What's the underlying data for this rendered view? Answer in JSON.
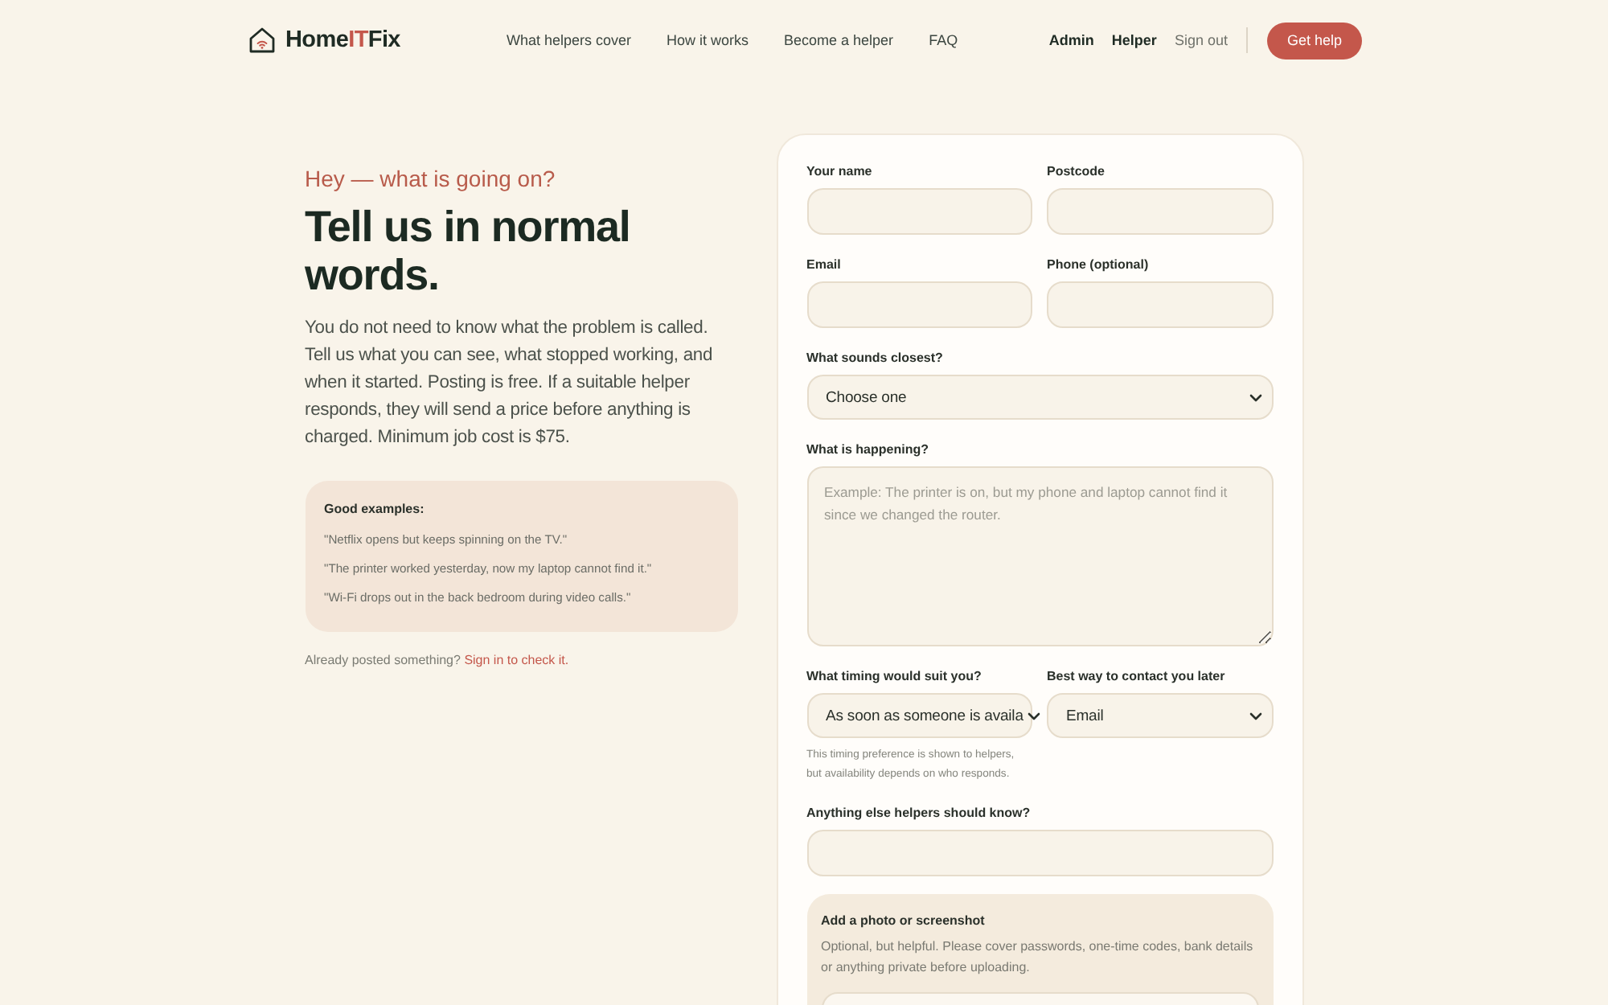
{
  "header": {
    "brand": {
      "prefix": "Home",
      "accent": "IT",
      "suffix": "Fix"
    },
    "nav": [
      {
        "label": "What helpers cover"
      },
      {
        "label": "How it works"
      },
      {
        "label": "Become a helper"
      },
      {
        "label": "FAQ"
      }
    ],
    "account_links": [
      {
        "label": "Admin",
        "kind": "strong"
      },
      {
        "label": "Helper",
        "kind": "strong"
      },
      {
        "label": "Sign out",
        "kind": "muted"
      }
    ],
    "cta": "Get help"
  },
  "intro": {
    "eyebrow": "Hey — what is going on?",
    "heading": "Tell us in normal words.",
    "body": "You do not need to know what the problem is called. Tell us what you can see, what stopped working, and when it started. Posting is free. If a suitable helper responds, they will send a price before anything is charged. Minimum job cost is $75.",
    "examples": {
      "title": "Good examples:",
      "items": [
        "\"Netflix opens but keeps spinning on the TV.\"",
        "\"The printer worked yesterday, now my laptop cannot find it.\"",
        "\"Wi-Fi drops out in the back bedroom during video calls.\""
      ]
    },
    "signin": {
      "text": "Already posted something?",
      "link": "Sign in to check it."
    }
  },
  "form": {
    "rows": [
      {
        "fields": [
          {
            "kind": "text",
            "label": "Your name"
          },
          {
            "kind": "text",
            "label": "Postcode"
          }
        ]
      },
      {
        "fields": [
          {
            "kind": "text",
            "label": "Email"
          },
          {
            "kind": "text",
            "label": "Phone (optional)"
          }
        ]
      },
      {
        "fields": [
          {
            "kind": "select",
            "label": "What sounds closest?",
            "value": "Choose one"
          }
        ]
      },
      {
        "fields": [
          {
            "kind": "textarea",
            "label": "What is happening?",
            "placeholder": "Example: The printer is on, but my phone and laptop cannot find it since we changed the router."
          }
        ]
      },
      {
        "fields": [
          {
            "kind": "select",
            "label": "What timing would suit you?",
            "value": "As soon as someone is availa",
            "hint": "This timing preference is shown to helpers, but availability depends on who responds."
          },
          {
            "kind": "select",
            "label": "Best way to contact you later",
            "value": "Email"
          }
        ]
      },
      {
        "fields": [
          {
            "kind": "text",
            "label": "Anything else helpers should know?"
          }
        ]
      }
    ],
    "upload": {
      "title": "Add a photo or screenshot",
      "description": "Optional, but helpful. Please cover passwords, one-time codes, bank details or anything private before uploading."
    }
  }
}
